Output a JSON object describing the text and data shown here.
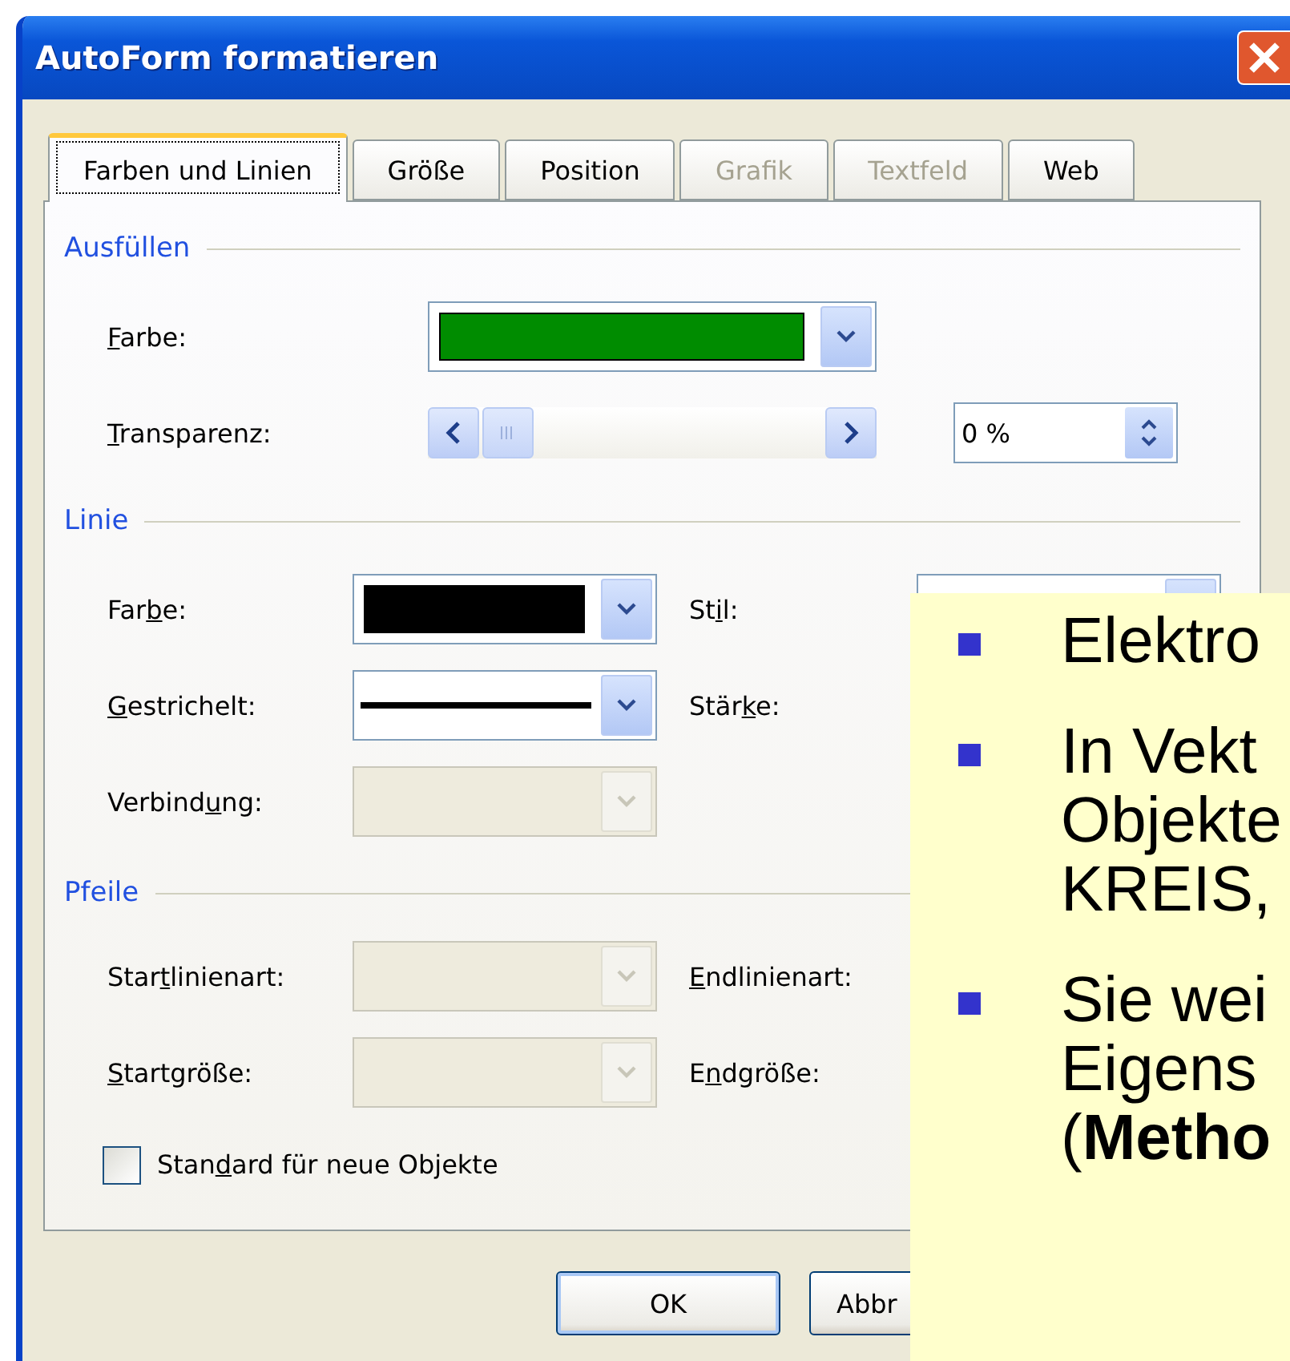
{
  "window": {
    "title": "AutoForm formatieren"
  },
  "tabs": [
    {
      "label": "Farben und Linien",
      "selected": true,
      "disabled": false
    },
    {
      "label": "Größe",
      "selected": false,
      "disabled": false
    },
    {
      "label": "Position",
      "selected": false,
      "disabled": false
    },
    {
      "label": "Grafik",
      "selected": false,
      "disabled": true
    },
    {
      "label": "Textfeld",
      "selected": false,
      "disabled": true
    },
    {
      "label": "Web",
      "selected": false,
      "disabled": false
    }
  ],
  "fill": {
    "heading": "Ausfüllen",
    "color": {
      "label": {
        "key": "F",
        "post": "arbe:"
      },
      "color": "#008c00"
    },
    "transparency": {
      "label": {
        "key": "T",
        "post": "ransparenz:"
      },
      "value": "0 %"
    }
  },
  "line": {
    "heading": "Linie",
    "color": {
      "label": {
        "pre": "Far",
        "key": "b",
        "post": "e:"
      },
      "color": "#000000",
      "disabled": false
    },
    "dashed": {
      "label": {
        "key": "G",
        "post": "estrichelt:"
      },
      "disabled": false
    },
    "join": {
      "label": {
        "pre": "Verbind",
        "key": "u",
        "post": "ng:"
      },
      "disabled": true
    },
    "style": {
      "label": {
        "pre": "St",
        "key": "i",
        "post": "l:"
      }
    },
    "weight": {
      "label": {
        "pre": "Stär",
        "key": "k",
        "post": "e:"
      }
    }
  },
  "arrows": {
    "heading": "Pfeile",
    "begin_style": {
      "label": {
        "pre": "Star",
        "key": "t",
        "post": "linienart:"
      },
      "disabled": true
    },
    "begin_size": {
      "label": {
        "key": "S",
        "post": "tartgröße:"
      },
      "disabled": true
    },
    "end_style": {
      "label": {
        "key": "E",
        "post": "ndlinienart:"
      }
    },
    "end_size": {
      "label": {
        "pre": "E",
        "key": "n",
        "post": "dgröße:"
      }
    }
  },
  "default_checkbox": {
    "label": {
      "pre": "Stan",
      "key": "d",
      "post": "ard für neue Objekte"
    },
    "checked": false
  },
  "buttons": [
    {
      "label": "OK"
    },
    {
      "label": "Abbr"
    }
  ],
  "slide": {
    "bullets": [
      {
        "lines": [
          "Elektro"
        ]
      },
      {
        "lines": [
          "In Vekt",
          "Objekte",
          "KREIS,"
        ]
      },
      {
        "lines": [
          "Sie wei",
          "Eigens",
          "(**Metho**"
        ]
      }
    ]
  }
}
